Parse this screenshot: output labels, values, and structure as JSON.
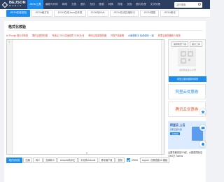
{
  "brand": {
    "name": "BEJSON",
    "tagline": "W O R L D"
  },
  "topnav": {
    "items": [
      "JSON工具",
      "编程与代码",
      "网络",
      "文档",
      "图片",
      "在线",
      "图表",
      "转换",
      "其他",
      "文档",
      "图片处理",
      "文字处理"
    ],
    "search_placeholder": "站内搜索"
  },
  "subnav": {
    "items": [
      "JSON在线校验",
      "JSON格式化",
      "JSON在线Java实体类",
      "JSON转XML",
      "JSON在线压缩转义",
      "JSON视图",
      "JSON美化"
    ]
  },
  "page": {
    "title": "格式化校验"
  },
  "ads": [
    {
      "text": "AI Prompt 提示词系统",
      "color": "red"
    },
    {
      "text": "限时云服务特惠",
      "color": "red"
    },
    {
      "text": "专线云 CN2 高速优质 ￥30/元/月",
      "color": "red"
    },
    {
      "text": "腾讯云轻量服务器",
      "color": "red"
    },
    {
      "text": "开发产品套餐",
      "color": "red"
    },
    {
      "text": "AI编程助手 免费使用 一键",
      "color": "blue"
    },
    {
      "text": "阿里云服务器新人特惠",
      "color": "red"
    }
  ],
  "editor": {
    "line_number": "1",
    "resize_handle": "≡"
  },
  "toolbar": {
    "buttons": [
      "格式化校验",
      "压缩",
      "转义",
      "去除转义",
      "Unicode转中文",
      "中文转Unicode",
      "移动端下载",
      "复制"
    ],
    "check_label": "JSON",
    "select_label": "Layout - 优秀线路 UI 模板"
  },
  "right_panel": {
    "buttons": [
      "提供免费下载",
      "提交工具"
    ],
    "qr_caption": "请扫码关注公众号",
    "strip_text": "阿里云服务器限时特惠",
    "ad1": "阿里云优惠券",
    "ad2": "腾讯云优惠券",
    "promo": {
      "title": "阿里云·上云",
      "sub": "领取云服务器",
      "button": "立即抢购"
    },
    "text": "云服务器低至9.9起，大模型限免至7000万 Tokens"
  },
  "colors": {
    "nav_bg": "#2c3e60",
    "accent": "#1d8cf0",
    "ad_red": "#e03e2d"
  }
}
